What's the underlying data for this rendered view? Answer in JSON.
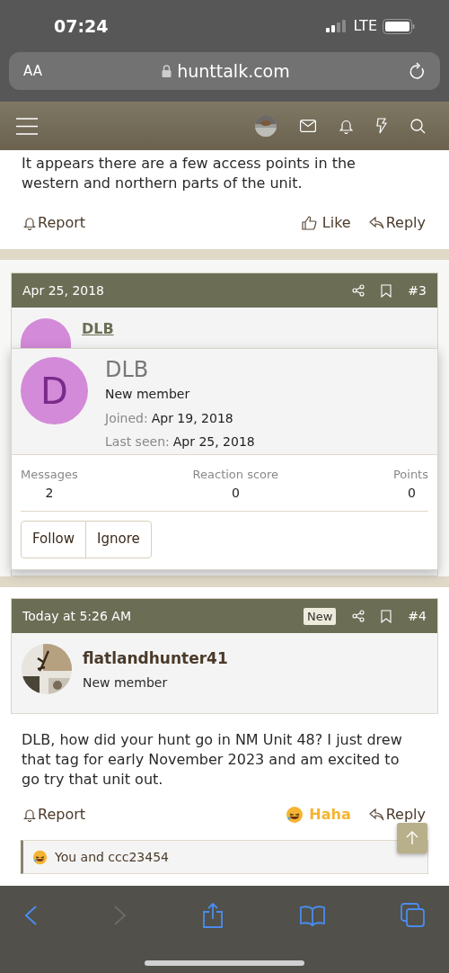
{
  "status_bar": {
    "time": "07:24",
    "network": "LTE"
  },
  "browser": {
    "text_size": "AA",
    "url": "hunttalk.com"
  },
  "previous_post": {
    "body": "It appears there are a few access points in the western and northern parts of the unit.",
    "report": "Report",
    "reaction": {
      "label": "Like",
      "selected": false
    },
    "reply": "Reply"
  },
  "post_3": {
    "date": "Apr 25, 2018",
    "number": "#3",
    "author": "DLB"
  },
  "member_card": {
    "avatar_letter": "D",
    "name": "DLB",
    "role": "New member",
    "joined_label": "Joined:",
    "joined": "Apr 19, 2018",
    "last_seen_label": "Last seen:",
    "last_seen": "Apr 25, 2018",
    "stats": [
      {
        "label": "Messages",
        "value": "2"
      },
      {
        "label": "Reaction score",
        "value": "0"
      },
      {
        "label": "Points",
        "value": "0"
      }
    ],
    "buttons": [
      "Follow",
      "Ignore"
    ]
  },
  "post_4": {
    "date": "Today at 5:26 AM",
    "badge": "New",
    "number": "#4",
    "author": "flatlandhunter41",
    "role": "New member",
    "body": "DLB, how did your hunt go in NM Unit 48? I just drew that tag for early November 2023 and am excited to go try that unit out.",
    "report": "Report",
    "reaction": {
      "label": "Haha",
      "selected": true
    },
    "reply": "Reply",
    "reactions_summary": "You and ccc23454"
  }
}
